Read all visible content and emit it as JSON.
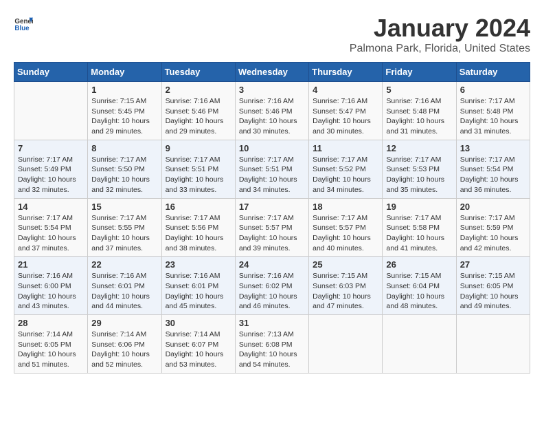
{
  "header": {
    "logo_general": "General",
    "logo_blue": "Blue",
    "month_title": "January 2024",
    "location": "Palmona Park, Florida, United States"
  },
  "days_of_week": [
    "Sunday",
    "Monday",
    "Tuesday",
    "Wednesday",
    "Thursday",
    "Friday",
    "Saturday"
  ],
  "weeks": [
    [
      {
        "day": "",
        "info": ""
      },
      {
        "day": "1",
        "info": "Sunrise: 7:15 AM\nSunset: 5:45 PM\nDaylight: 10 hours\nand 29 minutes."
      },
      {
        "day": "2",
        "info": "Sunrise: 7:16 AM\nSunset: 5:46 PM\nDaylight: 10 hours\nand 29 minutes."
      },
      {
        "day": "3",
        "info": "Sunrise: 7:16 AM\nSunset: 5:46 PM\nDaylight: 10 hours\nand 30 minutes."
      },
      {
        "day": "4",
        "info": "Sunrise: 7:16 AM\nSunset: 5:47 PM\nDaylight: 10 hours\nand 30 minutes."
      },
      {
        "day": "5",
        "info": "Sunrise: 7:16 AM\nSunset: 5:48 PM\nDaylight: 10 hours\nand 31 minutes."
      },
      {
        "day": "6",
        "info": "Sunrise: 7:17 AM\nSunset: 5:48 PM\nDaylight: 10 hours\nand 31 minutes."
      }
    ],
    [
      {
        "day": "7",
        "info": "Sunrise: 7:17 AM\nSunset: 5:49 PM\nDaylight: 10 hours\nand 32 minutes."
      },
      {
        "day": "8",
        "info": "Sunrise: 7:17 AM\nSunset: 5:50 PM\nDaylight: 10 hours\nand 32 minutes."
      },
      {
        "day": "9",
        "info": "Sunrise: 7:17 AM\nSunset: 5:51 PM\nDaylight: 10 hours\nand 33 minutes."
      },
      {
        "day": "10",
        "info": "Sunrise: 7:17 AM\nSunset: 5:51 PM\nDaylight: 10 hours\nand 34 minutes."
      },
      {
        "day": "11",
        "info": "Sunrise: 7:17 AM\nSunset: 5:52 PM\nDaylight: 10 hours\nand 34 minutes."
      },
      {
        "day": "12",
        "info": "Sunrise: 7:17 AM\nSunset: 5:53 PM\nDaylight: 10 hours\nand 35 minutes."
      },
      {
        "day": "13",
        "info": "Sunrise: 7:17 AM\nSunset: 5:54 PM\nDaylight: 10 hours\nand 36 minutes."
      }
    ],
    [
      {
        "day": "14",
        "info": "Sunrise: 7:17 AM\nSunset: 5:54 PM\nDaylight: 10 hours\nand 37 minutes."
      },
      {
        "day": "15",
        "info": "Sunrise: 7:17 AM\nSunset: 5:55 PM\nDaylight: 10 hours\nand 37 minutes."
      },
      {
        "day": "16",
        "info": "Sunrise: 7:17 AM\nSunset: 5:56 PM\nDaylight: 10 hours\nand 38 minutes."
      },
      {
        "day": "17",
        "info": "Sunrise: 7:17 AM\nSunset: 5:57 PM\nDaylight: 10 hours\nand 39 minutes."
      },
      {
        "day": "18",
        "info": "Sunrise: 7:17 AM\nSunset: 5:57 PM\nDaylight: 10 hours\nand 40 minutes."
      },
      {
        "day": "19",
        "info": "Sunrise: 7:17 AM\nSunset: 5:58 PM\nDaylight: 10 hours\nand 41 minutes."
      },
      {
        "day": "20",
        "info": "Sunrise: 7:17 AM\nSunset: 5:59 PM\nDaylight: 10 hours\nand 42 minutes."
      }
    ],
    [
      {
        "day": "21",
        "info": "Sunrise: 7:16 AM\nSunset: 6:00 PM\nDaylight: 10 hours\nand 43 minutes."
      },
      {
        "day": "22",
        "info": "Sunrise: 7:16 AM\nSunset: 6:01 PM\nDaylight: 10 hours\nand 44 minutes."
      },
      {
        "day": "23",
        "info": "Sunrise: 7:16 AM\nSunset: 6:01 PM\nDaylight: 10 hours\nand 45 minutes."
      },
      {
        "day": "24",
        "info": "Sunrise: 7:16 AM\nSunset: 6:02 PM\nDaylight: 10 hours\nand 46 minutes."
      },
      {
        "day": "25",
        "info": "Sunrise: 7:15 AM\nSunset: 6:03 PM\nDaylight: 10 hours\nand 47 minutes."
      },
      {
        "day": "26",
        "info": "Sunrise: 7:15 AM\nSunset: 6:04 PM\nDaylight: 10 hours\nand 48 minutes."
      },
      {
        "day": "27",
        "info": "Sunrise: 7:15 AM\nSunset: 6:05 PM\nDaylight: 10 hours\nand 49 minutes."
      }
    ],
    [
      {
        "day": "28",
        "info": "Sunrise: 7:14 AM\nSunset: 6:05 PM\nDaylight: 10 hours\nand 51 minutes."
      },
      {
        "day": "29",
        "info": "Sunrise: 7:14 AM\nSunset: 6:06 PM\nDaylight: 10 hours\nand 52 minutes."
      },
      {
        "day": "30",
        "info": "Sunrise: 7:14 AM\nSunset: 6:07 PM\nDaylight: 10 hours\nand 53 minutes."
      },
      {
        "day": "31",
        "info": "Sunrise: 7:13 AM\nSunset: 6:08 PM\nDaylight: 10 hours\nand 54 minutes."
      },
      {
        "day": "",
        "info": ""
      },
      {
        "day": "",
        "info": ""
      },
      {
        "day": "",
        "info": ""
      }
    ]
  ]
}
